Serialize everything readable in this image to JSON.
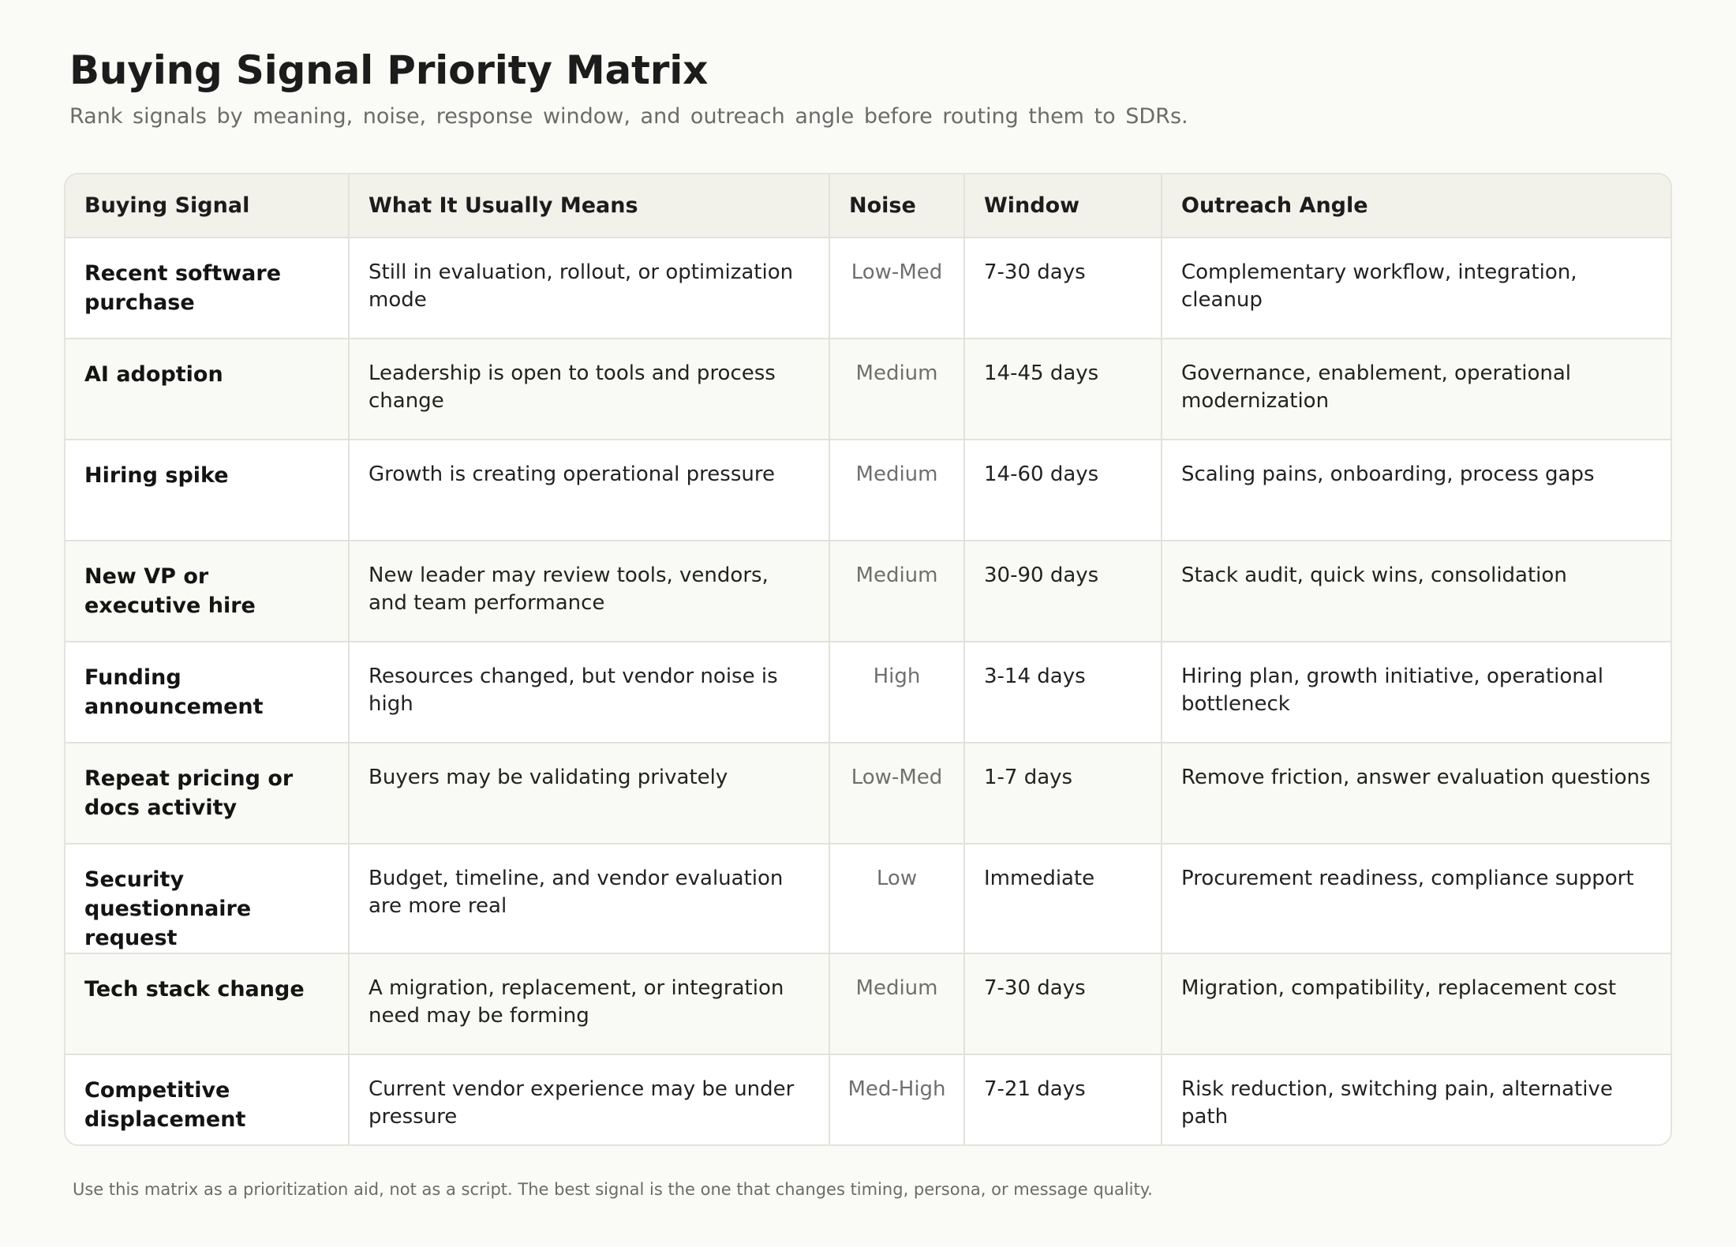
{
  "title": "Buying Signal Priority Matrix",
  "subtitle": "Rank signals by meaning, noise, response window, and outreach angle before routing them to SDRs.",
  "table": {
    "headers": [
      "Buying Signal",
      "What It Usually Means",
      "Noise",
      "Window",
      "Outreach Angle"
    ],
    "rows": [
      {
        "signal": "Recent software purchase",
        "meaning": "Still in evaluation, rollout, or optimization mode",
        "noise": "Low-Med",
        "window": "7-30 days",
        "angle": "Complementary workflow, integration, cleanup"
      },
      {
        "signal": "AI adoption",
        "meaning": "Leadership is open to tools and process change",
        "noise": "Medium",
        "window": "14-45 days",
        "angle": "Governance, enablement, operational modernization"
      },
      {
        "signal": "Hiring spike",
        "meaning": "Growth is creating operational pressure",
        "noise": "Medium",
        "window": "14-60 days",
        "angle": "Scaling pains, onboarding, process gaps"
      },
      {
        "signal": "New VP or executive hire",
        "meaning": "New leader may review tools, vendors, and team performance",
        "noise": "Medium",
        "window": "30-90 days",
        "angle": "Stack audit, quick wins, consolidation"
      },
      {
        "signal": "Funding announcement",
        "meaning": "Resources changed, but vendor noise is high",
        "noise": "High",
        "window": "3-14 days",
        "angle": "Hiring plan, growth initiative, operational bottleneck"
      },
      {
        "signal": "Repeat pricing or docs activity",
        "meaning": "Buyers may be validating privately",
        "noise": "Low-Med",
        "window": "1-7 days",
        "angle": "Remove friction, answer evaluation questions"
      },
      {
        "signal": "Security questionnaire request",
        "meaning": "Budget, timeline, and vendor evaluation are more real",
        "noise": "Low",
        "window": "Immediate",
        "angle": "Procurement readiness, compliance support"
      },
      {
        "signal": "Tech stack change",
        "meaning": "A migration, replacement, or integration need may be forming",
        "noise": "Medium",
        "window": "7-30 days",
        "angle": "Migration, compatibility, replacement cost"
      },
      {
        "signal": "Competitive displacement",
        "meaning": "Current vendor experience may be under pressure",
        "noise": "Med-High",
        "window": "7-21 days",
        "angle": "Risk reduction, switching pain, alternative path"
      }
    ]
  },
  "footnote": "Use this matrix as a prioritization aid, not as a script. The best signal is the one that changes timing, persona, or message quality."
}
